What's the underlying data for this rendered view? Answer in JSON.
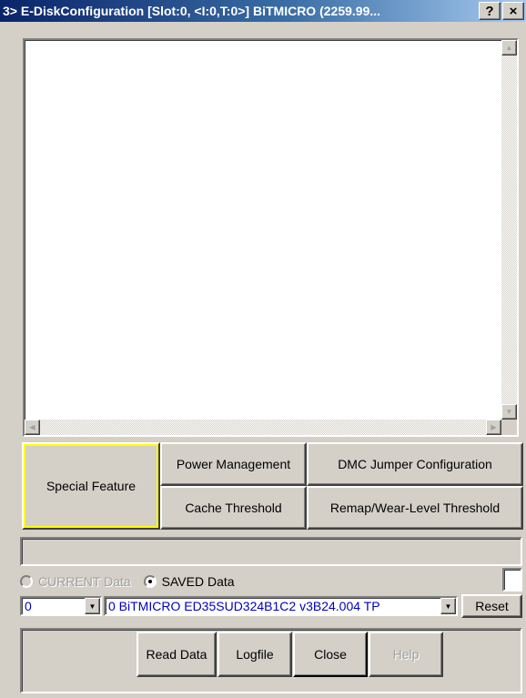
{
  "window": {
    "title": "3> E-DiskConfiguration [Slot:0, <I:0,T:0>] BiTMICRO (2259.99...",
    "help_glyph": "?",
    "close_glyph": "×"
  },
  "tabs": {
    "special_feature": "Special Feature",
    "power_management": "Power Management",
    "dmc_jumper": "DMC Jumper Configuration",
    "cache_threshold": "Cache Threshold",
    "remap_wear": "Remap/Wear-Level Threshold"
  },
  "status": {
    "text": ""
  },
  "data_source": {
    "current_label": "CURRENT Data",
    "saved_label": "SAVED Data",
    "selected": "SAVED Data"
  },
  "selectors": {
    "index_value": "0",
    "device_value": "0  BiTMICRO ED35SUD324B1C2  v3B24.004 TP",
    "reset_label": "Reset"
  },
  "actions": {
    "read_data": "Read Data",
    "logfile": "Logfile",
    "close": "Close",
    "help": "Help"
  },
  "colors": {
    "face": "#d4d0c8",
    "title_start": "#0a246a",
    "title_end": "#a6caf0",
    "combo_text": "#0000c0",
    "focus_outline": "#ffff00"
  }
}
